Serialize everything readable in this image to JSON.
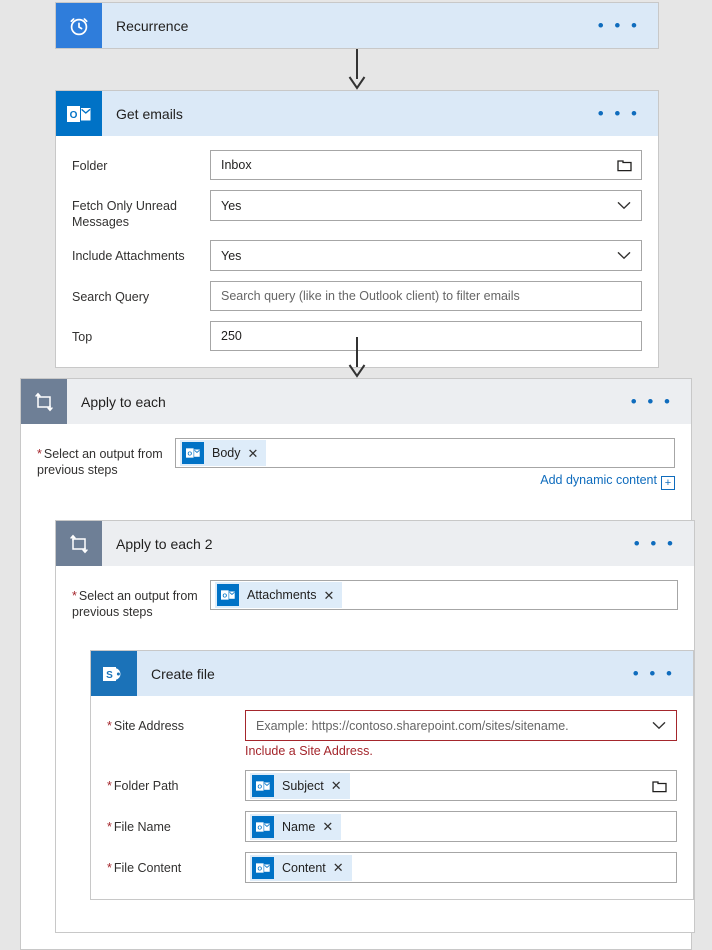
{
  "flow": {
    "steps": [
      {
        "id": "recurrence",
        "title": "Recurrence",
        "icon": "recurrence-clock-icon",
        "menu": "• • •"
      },
      {
        "id": "get-emails",
        "title": "Get emails",
        "icon": "outlook-icon",
        "menu": "• • •",
        "fields": [
          {
            "label": "Folder",
            "value": "Inbox",
            "placeholder": "",
            "control": "folder-picker"
          },
          {
            "label": "Fetch Only Unread Messages",
            "value": "Yes",
            "placeholder": "",
            "control": "dropdown"
          },
          {
            "label": "Include Attachments",
            "value": "Yes",
            "placeholder": "",
            "control": "dropdown"
          },
          {
            "label": "Search Query",
            "value": "",
            "placeholder": "Search query (like in the Outlook client) to filter emails",
            "control": "text"
          },
          {
            "label": "Top",
            "value": "250",
            "placeholder": "",
            "control": "text"
          }
        ]
      },
      {
        "id": "apply-to-each",
        "title": "Apply to each",
        "icon": "loop-icon",
        "menu": "• • •",
        "output_label": "Select an output from previous steps",
        "required": true,
        "token": {
          "text": "Body",
          "icon": "outlook-icon",
          "remove": "✕"
        },
        "add_dynamic_content": "Add dynamic content",
        "add_dynamic_content_plus": "+"
      },
      {
        "id": "apply-to-each-2",
        "title": "Apply to each 2",
        "icon": "loop-icon",
        "menu": "• • •",
        "output_label": "Select an output from previous steps",
        "required": true,
        "token": {
          "text": "Attachments",
          "icon": "outlook-icon",
          "remove": "✕"
        }
      },
      {
        "id": "create-file",
        "title": "Create file",
        "icon": "sharepoint-icon",
        "menu": "• • •",
        "fields": [
          {
            "label": "Site Address",
            "required": true,
            "value": "",
            "placeholder": "Example: https://contoso.sharepoint.com/sites/sitename.",
            "control": "dropdown",
            "error": "Include a Site Address."
          },
          {
            "label": "Folder Path",
            "required": true,
            "token": {
              "text": "Subject",
              "icon": "outlook-icon",
              "remove": "✕"
            },
            "control": "folder-picker"
          },
          {
            "label": "File Name",
            "required": true,
            "token": {
              "text": "Name",
              "icon": "outlook-icon",
              "remove": "✕"
            },
            "control": "token"
          },
          {
            "label": "File Content",
            "required": true,
            "token": {
              "text": "Content",
              "icon": "outlook-icon",
              "remove": "✕"
            },
            "control": "token"
          }
        ]
      }
    ]
  },
  "colors": {
    "header_blue": "#dbe9f7",
    "header_gray": "#eceef1",
    "recurrence_tile": "#2f7ddb",
    "outlook_tile": "#0072c6",
    "sharepoint_tile": "#1b72b8",
    "loop_tile": "#6e7f96",
    "link_blue": "#0f6cbd",
    "error_red": "#a4262c",
    "canvas": "#e6e6e6"
  }
}
